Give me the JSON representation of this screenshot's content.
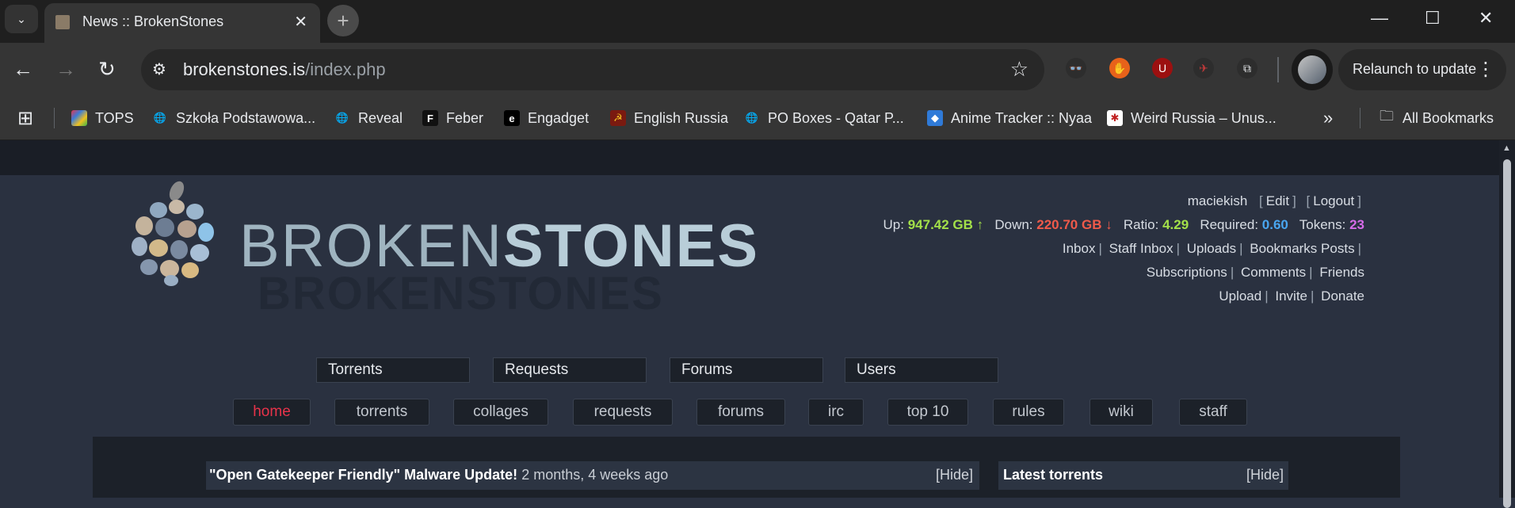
{
  "browser": {
    "tab_title": "News :: BrokenStones",
    "url_host": "brokenstones.is",
    "url_path": "/index.php",
    "relaunch_label": "Relaunch to update",
    "window_controls": {
      "minimize": "—",
      "maximize": "☐",
      "close": "✕"
    },
    "bookmarks": [
      {
        "label": "TOPS",
        "icon": "tops-icon"
      },
      {
        "label": "Szkoła Podstawowa...",
        "icon": "globe-icon"
      },
      {
        "label": "Reveal",
        "icon": "globe-icon"
      },
      {
        "label": "Feber",
        "icon": "feber-icon"
      },
      {
        "label": "Engadget",
        "icon": "engadget-icon"
      },
      {
        "label": "English Russia",
        "icon": "english-russia-icon"
      },
      {
        "label": "PO Boxes - Qatar P...",
        "icon": "globe-icon"
      },
      {
        "label": "Anime Tracker :: Nyaa",
        "icon": "nyaa-icon"
      },
      {
        "label": "Weird Russia – Unus...",
        "icon": "weird-russia-icon"
      }
    ],
    "all_bookmarks_label": "All Bookmarks",
    "overflow_label": "»"
  },
  "logo": {
    "part1": "BROKEN",
    "part2": "STONES"
  },
  "user": {
    "name": "maciekish",
    "edit": "Edit",
    "logout": "Logout",
    "up_label": "Up:",
    "up_value": "947.42 GB",
    "down_label": "Down:",
    "down_value": "220.70 GB",
    "ratio_label": "Ratio:",
    "ratio_value": "4.29",
    "required_label": "Required:",
    "required_value": "0.60",
    "tokens_label": "Tokens:",
    "tokens_value": "23",
    "links_row1": [
      "Inbox",
      "Staff Inbox",
      "Uploads",
      "Bookmarks",
      "Posts"
    ],
    "links_row2": [
      "Subscriptions",
      "Comments",
      "Friends"
    ],
    "links_row3": [
      "Upload",
      "Invite",
      "Donate"
    ]
  },
  "main_menu": [
    "Torrents",
    "Requests",
    "Forums",
    "Users"
  ],
  "nav": [
    "home",
    "torrents",
    "collages",
    "requests",
    "forums",
    "irc",
    "top 10",
    "rules",
    "wiki",
    "staff"
  ],
  "news": {
    "title": "\"Open Gatekeeper Friendly\" Malware Update!",
    "ago": "2 months, 4 weeks ago",
    "hide": "[Hide]"
  },
  "latest": {
    "title": "Latest torrents",
    "hide": "[Hide]"
  },
  "colors": {
    "up": "#a3e049",
    "down": "#f05a4a",
    "required": "#49a6f0",
    "tokens": "#d66be8",
    "active_nav": "#e8334a"
  }
}
